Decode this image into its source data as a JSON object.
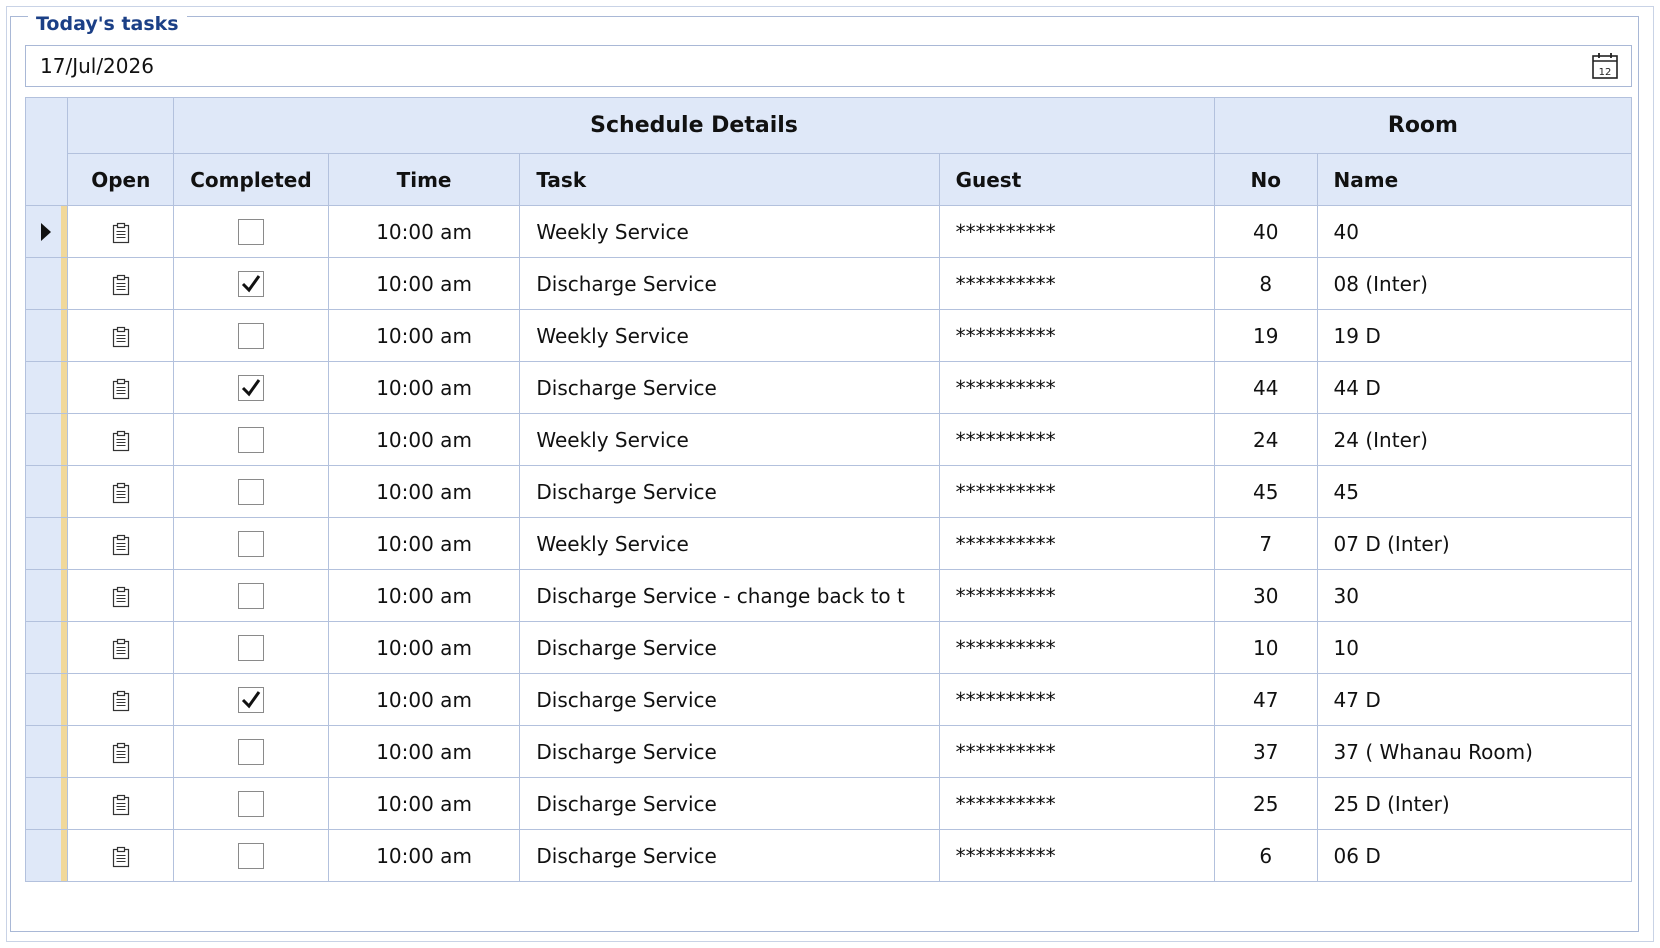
{
  "group": {
    "title": "Today's tasks"
  },
  "date_picker": {
    "value": "17/Jul/2026",
    "icon": "calendar-icon",
    "icon_day": "12"
  },
  "grid": {
    "bands": {
      "schedule": "Schedule Details",
      "room": "Room"
    },
    "columns": {
      "open": "Open",
      "completed": "Completed",
      "time": "Time",
      "task": "Task",
      "guest": "Guest",
      "room_no": "No",
      "room_name": "Name"
    },
    "rows": [
      {
        "completed": false,
        "time": "10:00 am",
        "task": "Weekly Service",
        "guest": "**********",
        "room_no": "40",
        "room_name": "40",
        "current": true
      },
      {
        "completed": true,
        "time": "10:00 am",
        "task": "Discharge Service",
        "guest": "**********",
        "room_no": "8",
        "room_name": "08 (Inter)"
      },
      {
        "completed": false,
        "time": "10:00 am",
        "task": "Weekly Service",
        "guest": "**********",
        "room_no": "19",
        "room_name": "19 D"
      },
      {
        "completed": true,
        "time": "10:00 am",
        "task": "Discharge Service",
        "guest": "**********",
        "room_no": "44",
        "room_name": "44 D"
      },
      {
        "completed": false,
        "time": "10:00 am",
        "task": "Weekly Service",
        "guest": "**********",
        "room_no": "24",
        "room_name": "24 (Inter)"
      },
      {
        "completed": false,
        "time": "10:00 am",
        "task": "Discharge Service",
        "guest": "**********",
        "room_no": "45",
        "room_name": "45"
      },
      {
        "completed": false,
        "time": "10:00 am",
        "task": "Weekly Service",
        "guest": "**********",
        "room_no": "7",
        "room_name": "07 D (Inter)"
      },
      {
        "completed": false,
        "time": "10:00 am",
        "task": "Discharge Service - change back to t",
        "guest": "**********",
        "room_no": "30",
        "room_name": "30"
      },
      {
        "completed": false,
        "time": "10:00 am",
        "task": "Discharge Service",
        "guest": "**********",
        "room_no": "10",
        "room_name": "10"
      },
      {
        "completed": true,
        "time": "10:00 am",
        "task": "Discharge Service",
        "guest": "**********",
        "room_no": "47",
        "room_name": "47 D"
      },
      {
        "completed": false,
        "time": "10:00 am",
        "task": "Discharge Service",
        "guest": "**********",
        "room_no": "37",
        "room_name": "37 ( Whanau Room)"
      },
      {
        "completed": false,
        "time": "10:00 am",
        "task": "Discharge Service",
        "guest": "**********",
        "room_no": "25",
        "room_name": "25 D (Inter)"
      },
      {
        "completed": false,
        "time": "10:00 am",
        "task": "Discharge Service",
        "guest": "**********",
        "room_no": "6",
        "room_name": "06 D"
      }
    ]
  },
  "icons": {
    "open": "clipboard-icon",
    "check": "checkmark-icon",
    "row_indicator": "triangle-right-icon"
  },
  "colors": {
    "header_bg": "#dfe8f8",
    "border": "#b3c1dd",
    "title": "#1b3f86",
    "row_marker": "#f1d89a"
  }
}
